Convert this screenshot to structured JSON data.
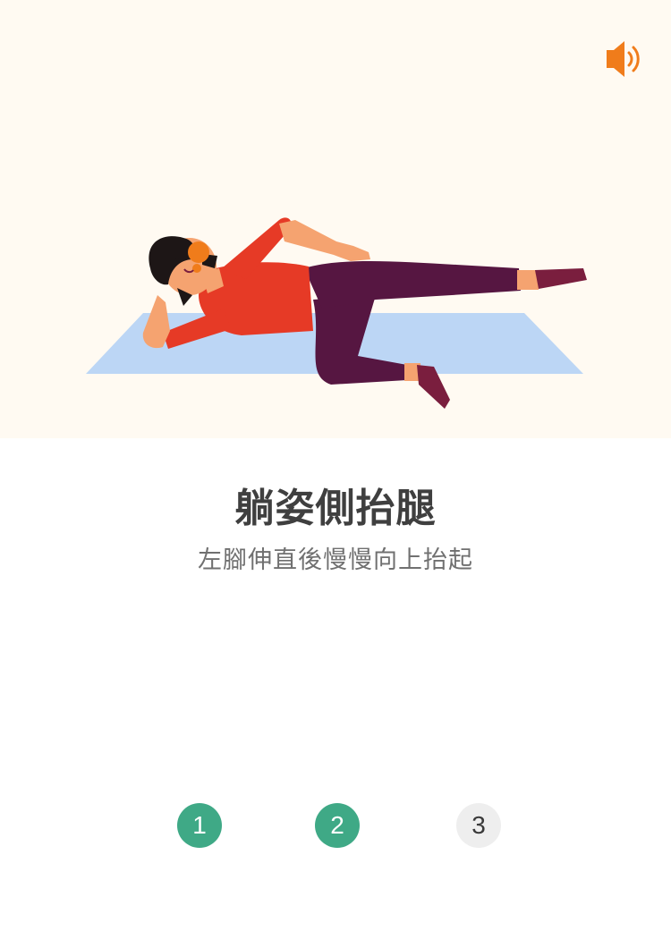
{
  "exercise": {
    "title": "躺姿側抬腿",
    "instruction": "左腳伸直後慢慢向上抬起"
  },
  "controls": {
    "sound_icon": "speaker-icon"
  },
  "steps": [
    {
      "label": "1",
      "state": "completed"
    },
    {
      "label": "2",
      "state": "completed"
    },
    {
      "label": "3",
      "state": "pending"
    }
  ],
  "colors": {
    "hero_background": "#fffaf2",
    "accent_orange": "#f07c1b",
    "step_done": "#3fa986",
    "step_pending": "#eeeeee",
    "mat": "#bcd6f5",
    "shirt": "#e63a26",
    "pants": "#561641"
  }
}
